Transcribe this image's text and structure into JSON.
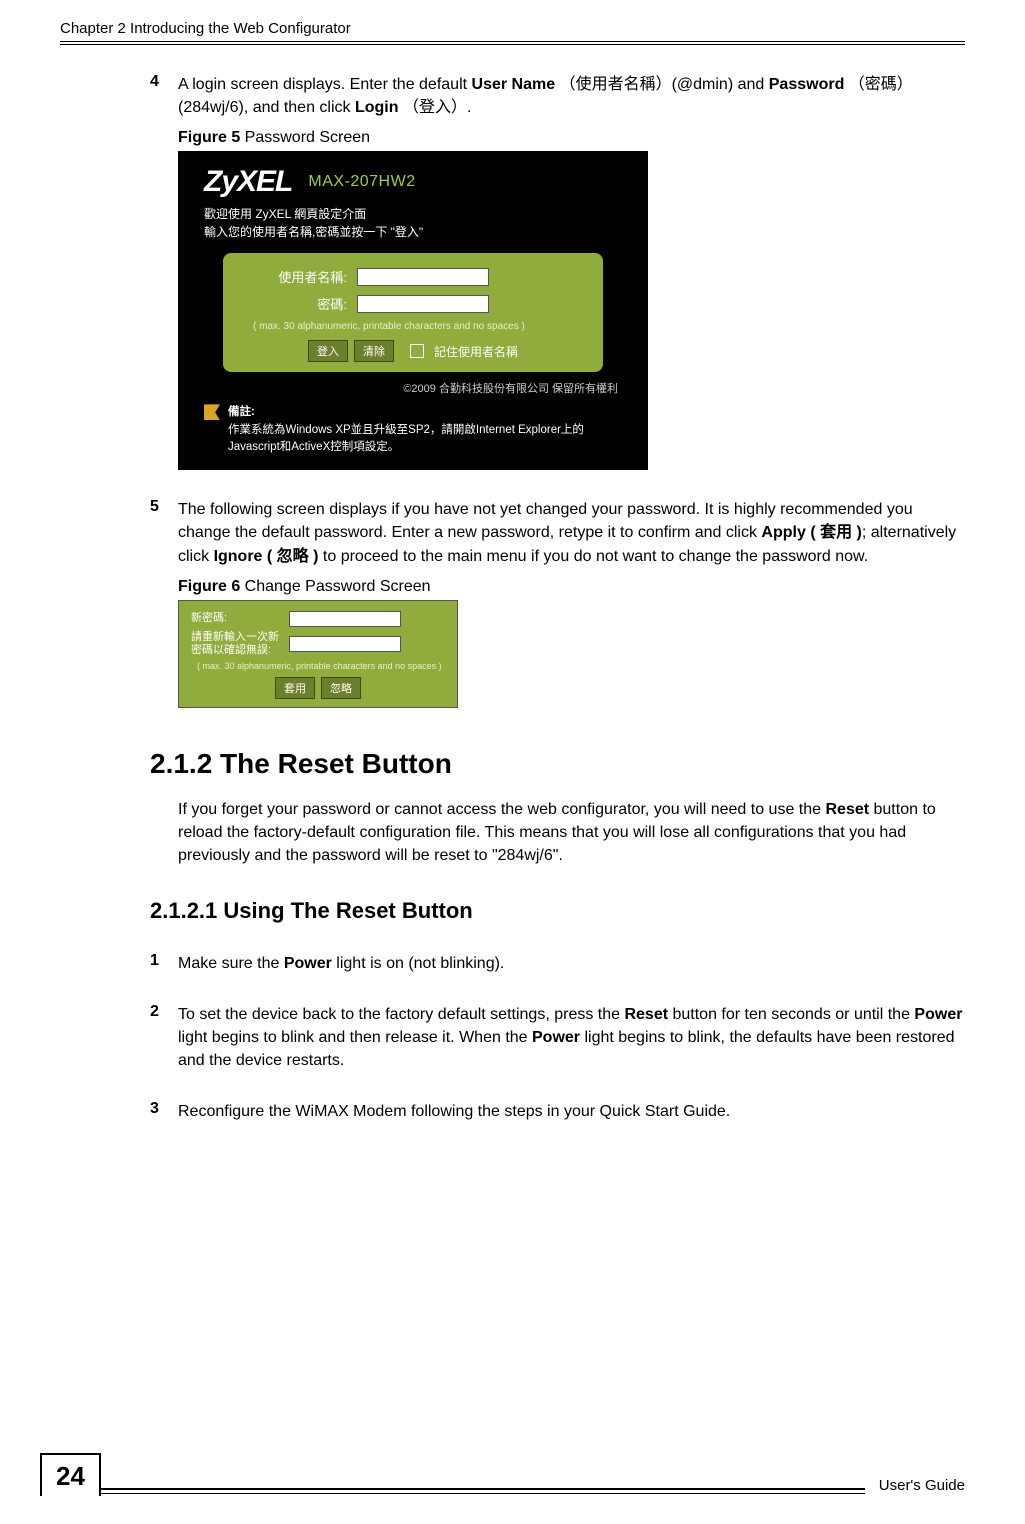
{
  "header": {
    "chapter": "Chapter 2 Introducing the Web Configurator"
  },
  "steps_a": {
    "s4": {
      "num": "4",
      "t1": "A login screen displays. ",
      "t2": "Enter the default ",
      "b1": "User Name",
      "t3": " （使用者名稱）(@dmin) and ",
      "b2": "Password",
      "t4": " （密碼）(284wj/6), and then click ",
      "b3": "Login",
      "t5": " （登入）."
    },
    "fig5_caption_bold": "Figure 5",
    "fig5_caption_rest": "   Password Screen",
    "s5": {
      "num": "5",
      "t1": "The following screen displays if you have not yet changed your password. It is highly recommended you change the default password. Enter a new password, retype it to confirm and click ",
      "b1": "Apply ( 套用 )",
      "t2": "; alternatively click ",
      "b2": "Ignore ( 忽略 )",
      "t3": " to proceed to the main menu if you do not want to change the password now."
    },
    "fig6_caption_bold": "Figure 6",
    "fig6_caption_rest": "   Change Password Screen"
  },
  "figure5": {
    "brand": "ZyXEL",
    "model": "MAX-207HW2",
    "welcome_l1": "歡迎使用 ZyXEL 網頁設定介面",
    "welcome_l2": "輸入您的使用者名稱,密碼並按一下 \"登入\"",
    "label_user": "使用者名稱:",
    "label_pass": "密碼:",
    "hint": "( max. 30 alphanumeric, printable characters and no spaces )",
    "btn_login": "登入",
    "btn_clear": "清除",
    "remember": "記住使用者名稱",
    "copyright": "©2009 合勤科技股份有限公司 保留所有權利",
    "note_title": "備註:",
    "note_body": "作業系統為Windows XP並且升級至SP2，請開啟Internet Explorer上的Javascript和ActiveX控制項設定。"
  },
  "figure6": {
    "label_new": "新密碼:",
    "label_confirm": "請重新輸入一次新密碼以確認無誤:",
    "hint": "( max. 30 alphanumeric, printable characters and no spaces )",
    "btn_apply": "套用",
    "btn_ignore": "忽略"
  },
  "section_212_title": "2.1.2  The Reset Button",
  "section_212_para": {
    "t1": "If you forget your password or cannot access the web configurator, you will need to use the ",
    "b1": "Reset",
    "t2": " button to reload the factory-default configuration file. This means that you will lose all configurations that you had previously and the password will be reset to \"284wj/6\"."
  },
  "section_2121_title": "2.1.2.1  Using The Reset Button",
  "steps_b": {
    "s1": {
      "num": "1",
      "t1": "Make sure the ",
      "b1": "Power",
      "t2": " light is on (not blinking)."
    },
    "s2": {
      "num": "2",
      "t1": "To set the device back to the factory default settings, press the ",
      "b1": "Reset",
      "t2": " button for ten seconds or until the ",
      "b2": "Power",
      "t3": " light begins to blink and then release it. When the ",
      "b3": "Power",
      "t4": " light begins to blink, the defaults have been restored and the device restarts."
    },
    "s3": {
      "num": "3",
      "t1": "Reconfigure the WiMAX Modem following the steps in your Quick Start Guide."
    }
  },
  "footer": {
    "page": "24",
    "guide": "User's Guide"
  }
}
